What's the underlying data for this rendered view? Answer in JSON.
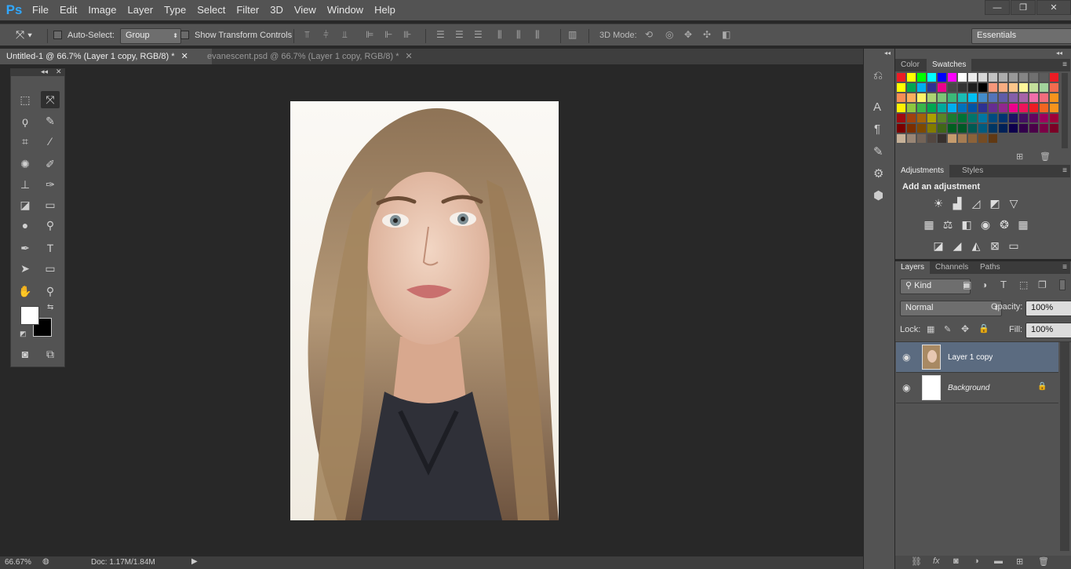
{
  "app": {
    "logo": "Ps"
  },
  "menu": [
    "File",
    "Edit",
    "Image",
    "Layer",
    "Type",
    "Select",
    "Filter",
    "3D",
    "View",
    "Window",
    "Help"
  ],
  "window_controls": {
    "minimize": "—",
    "restore": "❐",
    "close": "✕"
  },
  "options": {
    "auto_select_label": "Auto-Select:",
    "auto_select_value": "Group",
    "show_transform_label": "Show Transform Controls",
    "mode_3d_label": "3D Mode:",
    "workspace": "Essentials"
  },
  "tabs": [
    {
      "label": "Untitled-1 @ 66.7% (Layer 1 copy, RGB/8) *",
      "close": "✕"
    },
    {
      "label": "evanescent.psd @ 66.7% (Layer 1 copy, RGB/8) *",
      "close": "✕"
    }
  ],
  "status": {
    "zoom": "66.67%",
    "doc": "Doc: 1.17M/1.84M"
  },
  "panels": {
    "color_tab": "Color",
    "swatches_tab": "Swatches",
    "adjustments_tab": "Adjustments",
    "styles_tab": "Styles",
    "add_adjustment": "Add an adjustment",
    "layers_tab": "Layers",
    "channels_tab": "Channels",
    "paths_tab": "Paths",
    "kind_label": "Kind",
    "blend_mode": "Normal",
    "opacity_label": "Opacity:",
    "opacity_value": "100%",
    "lock_label": "Lock:",
    "fill_label": "Fill:",
    "fill_value": "100%"
  },
  "layers": [
    {
      "name": "Layer 1 copy",
      "selected": true
    },
    {
      "name": "Background",
      "selected": false,
      "locked": true
    }
  ],
  "swatch_rows": [
    [
      "#ed1c24",
      "#ffff00",
      "#00ff00",
      "#00ffff",
      "#0000ff",
      "#ff00ff",
      "#ffffff",
      "#ebebeb",
      "#d6d6d6",
      "#c2c2c2",
      "#adadad",
      "#999999",
      "#858585",
      "#707070",
      "#5c5c5c",
      "#ed1c24"
    ],
    [
      "#ffff00",
      "#00a651",
      "#00aeef",
      "#2e3192",
      "#ec008c",
      "#474747",
      "#333333",
      "#1f1f1f",
      "#000000",
      "#f7977a",
      "#f9ad81",
      "#fdc68a",
      "#fff79a",
      "#c4df9b",
      "#a2d39c",
      "#f26c4f"
    ],
    [
      "#f68e55",
      "#fbaf5c",
      "#fff467",
      "#acd372",
      "#7cc576",
      "#3bb878",
      "#1abbb4",
      "#00bff3",
      "#438ccb",
      "#5574b9",
      "#605ca8",
      "#855fa8",
      "#a763a8",
      "#f06ea9",
      "#f26d7d",
      "#f7941d"
    ],
    [
      "#fff200",
      "#8dc73f",
      "#39b54a",
      "#00a651",
      "#00a99d",
      "#00aeef",
      "#0072bc",
      "#0054a6",
      "#2e3192",
      "#662d91",
      "#92278f",
      "#ec008c",
      "#ed145b",
      "#ed1c24",
      "#f26522",
      "#f7941d"
    ],
    [
      "#9e0b0f",
      "#a0410d",
      "#a36209",
      "#aba000",
      "#598527",
      "#1a7b30",
      "#007236",
      "#00746b",
      "#0076a3",
      "#004b80",
      "#003471",
      "#1b1464",
      "#440e62",
      "#630460",
      "#9e005d",
      "#9e0039"
    ],
    [
      "#790000",
      "#7b2e00",
      "#7d4900",
      "#827b00",
      "#406618",
      "#005e20",
      "#005826",
      "#005952",
      "#005b7f",
      "#003663",
      "#002157",
      "#0d004c",
      "#32004b",
      "#4b0049",
      "#7b0046",
      "#7a0026"
    ],
    [
      "#c7b299",
      "#998675",
      "#736357",
      "#534741",
      "#37302d",
      "#c69c6d",
      "#a67c52",
      "#8c6239",
      "#754c24",
      "#603913"
    ]
  ]
}
